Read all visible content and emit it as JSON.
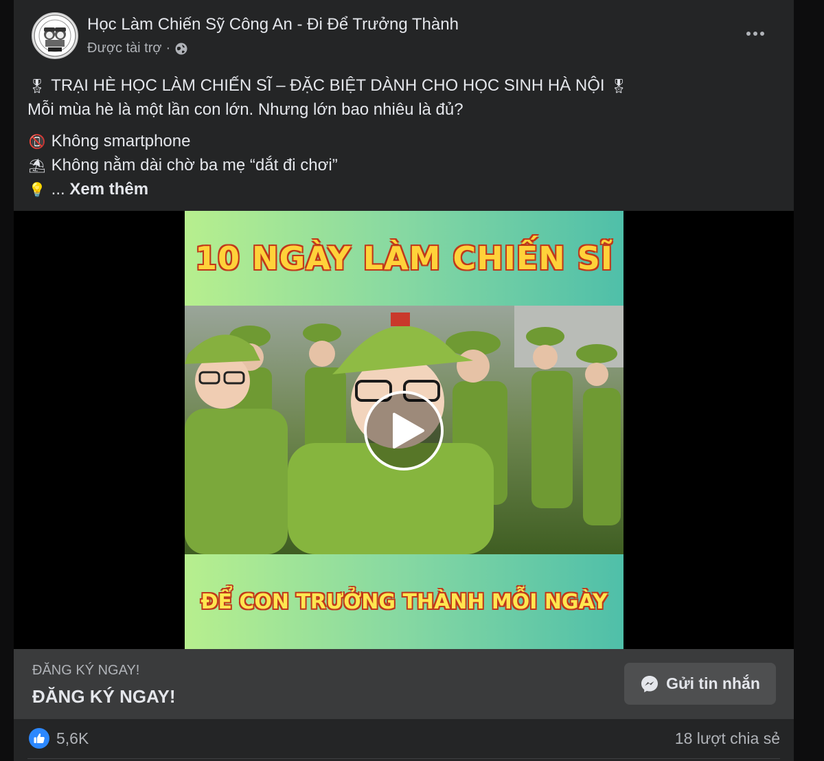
{
  "post": {
    "page_name": "Học Làm Chiến Sỹ Công An - Đi Để Trưởng Thành",
    "sponsored_label": "Được tài trợ",
    "separator": "·",
    "text": {
      "line1": "TRẠI HÈ HỌC LÀM CHIẾN SĨ – ĐẶC BIỆT DÀNH CHO HỌC SINH HÀ NỘI",
      "line2": "Mỗi mùa hè là một lần con lớn. Nhưng lớn bao nhiêu là đủ?",
      "item1": "Không smartphone",
      "item2": "Không nằm dài chờ ba mẹ “dắt đi chơi”",
      "ellipsis": "...",
      "see_more": "Xem thêm"
    },
    "emoji": {
      "medal": "🎖",
      "no_phone": "📵",
      "umbrella": "⛱",
      "bulb": "💡"
    }
  },
  "video": {
    "banner_top": "10 NGÀY LÀM CHIẾN SĨ",
    "banner_bottom": "ĐỂ CON TRƯỞNG THÀNH MỖI NGÀY"
  },
  "cta": {
    "small_label": "ĐĂNG KÝ NGAY!",
    "headline": "ĐĂNG KÝ NGAY!",
    "button_label": "Gửi tin nhắn"
  },
  "footer": {
    "reaction_count": "5,6K",
    "shares": "18 lượt chia sẻ"
  },
  "colors": {
    "card_bg": "#242526",
    "cta_bg": "#3a3b3c",
    "like_blue": "#2d88ff",
    "text_primary": "#e4e6eb",
    "text_secondary": "#b0b3b8"
  }
}
